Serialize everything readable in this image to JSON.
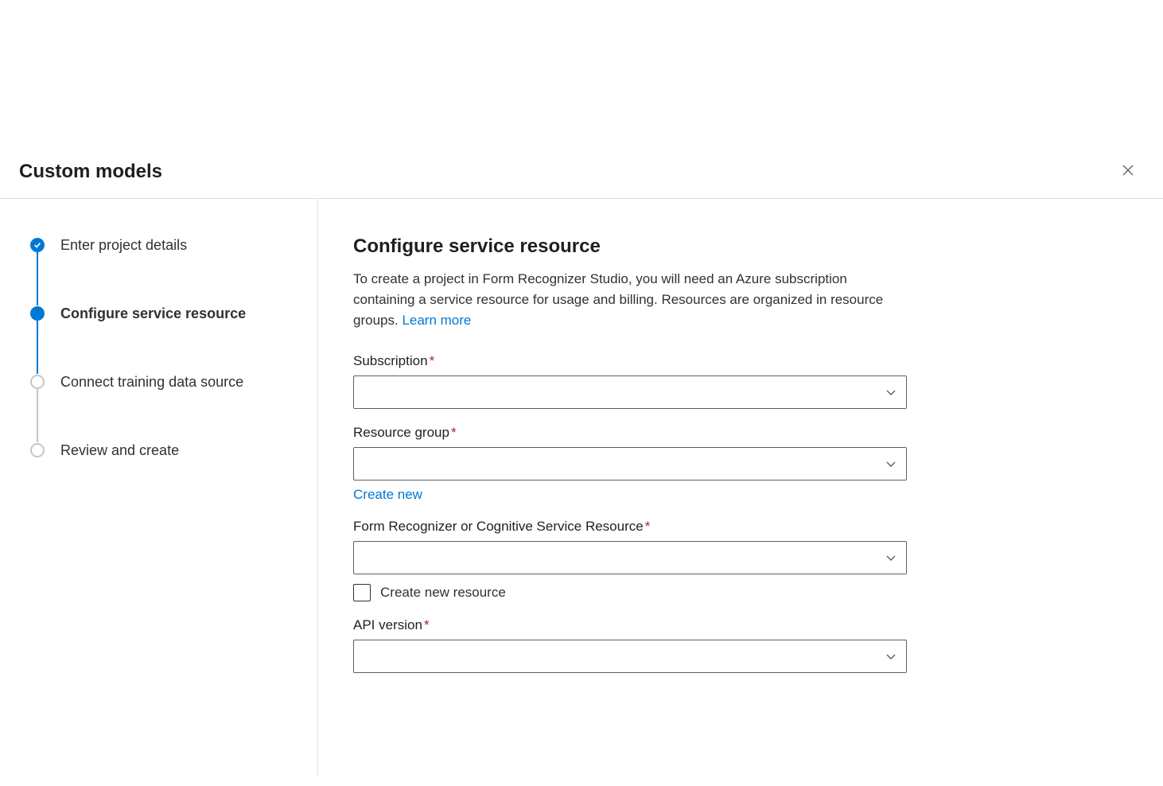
{
  "header": {
    "title": "Custom models"
  },
  "steps": {
    "items": [
      {
        "label": "Enter project details"
      },
      {
        "label": "Configure service resource"
      },
      {
        "label": "Connect training data source"
      },
      {
        "label": "Review and create"
      }
    ]
  },
  "main": {
    "title": "Configure service resource",
    "description": "To create a project in Form Recognizer Studio, you will need an Azure subscription containing a service resource for usage and billing. Resources are organized in resource groups. ",
    "learn_more": "Learn more",
    "fields": {
      "subscription": {
        "label": "Subscription",
        "value": ""
      },
      "resource_group": {
        "label": "Resource group",
        "value": "",
        "create_new": "Create new"
      },
      "service_resource": {
        "label": "Form Recognizer or Cognitive Service Resource",
        "value": "",
        "create_new_checkbox": "Create new resource",
        "checked": false
      },
      "api_version": {
        "label": "API version",
        "value": ""
      }
    }
  }
}
